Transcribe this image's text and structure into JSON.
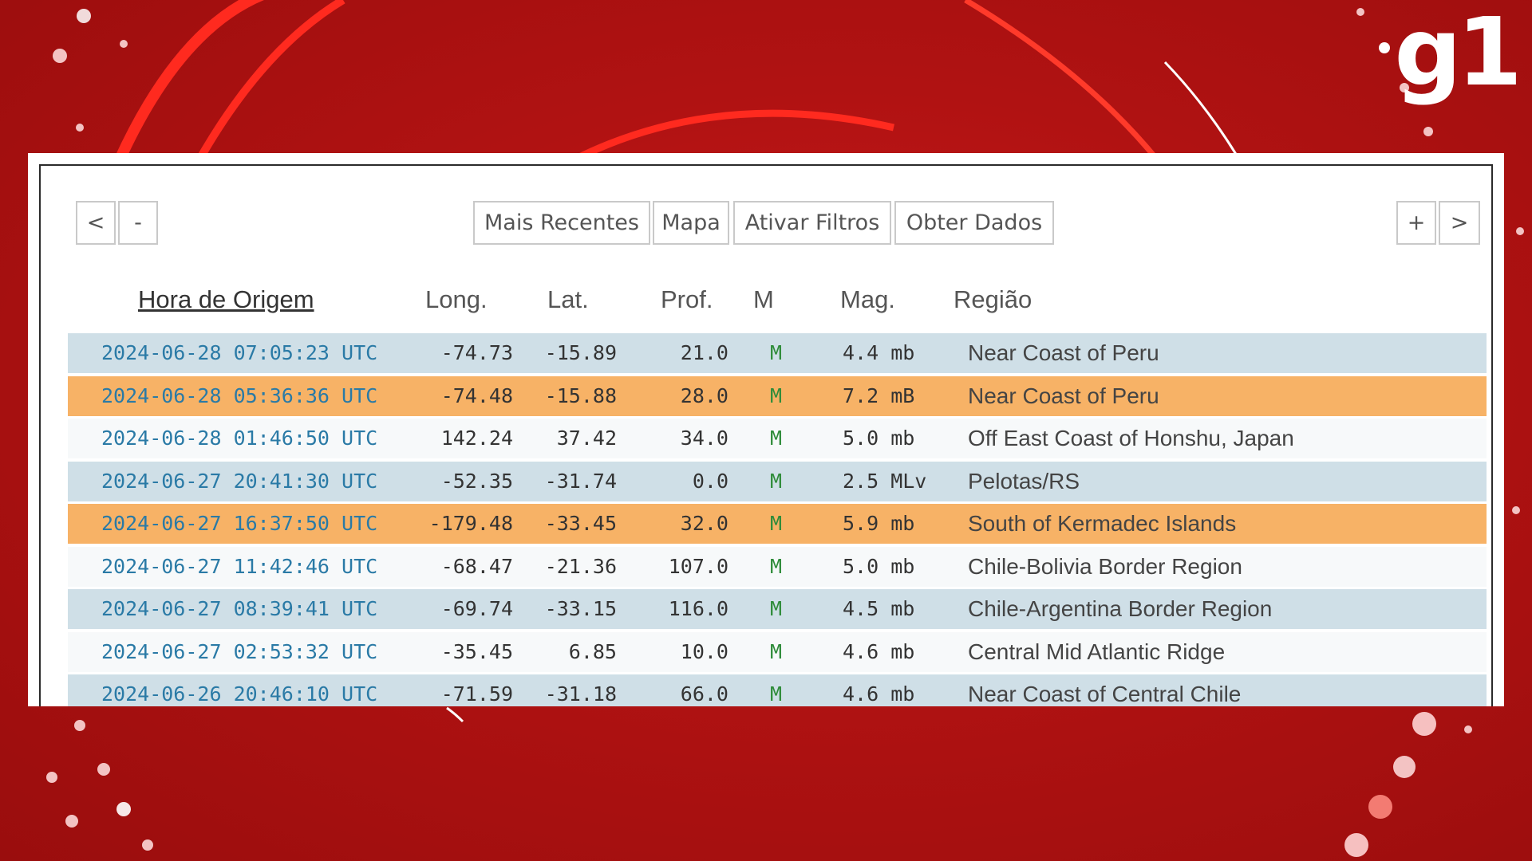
{
  "brand": {
    "logo_text": "g1",
    "accent": "#c8191a"
  },
  "toolbar": {
    "prev_label": "<",
    "zoom_out_label": "-",
    "recent_label": "Mais Recentes",
    "map_label": "Mapa",
    "filters_label": "Ativar Filtros",
    "data_label": "Obter Dados",
    "zoom_in_label": "+",
    "next_label": ">"
  },
  "table": {
    "headers": {
      "origin_time": "Hora de Origem",
      "longitude": "Long.",
      "latitude": "Lat.",
      "depth": "Prof.",
      "mode": "M",
      "magnitude": "Mag.",
      "region": "Região"
    },
    "rows": [
      {
        "time": "2024-06-28 07:05:23 UTC",
        "long": "-74.73",
        "lat": "-15.89",
        "prof": "21.0",
        "m": "M",
        "mag": "4.4 mb",
        "region": "Near Coast of Peru",
        "highlight": "blue"
      },
      {
        "time": "2024-06-28 05:36:36 UTC",
        "long": "-74.48",
        "lat": "-15.88",
        "prof": "28.0",
        "m": "M",
        "mag": "7.2 mB",
        "region": "Near Coast of Peru",
        "highlight": "orange"
      },
      {
        "time": "2024-06-28 01:46:50 UTC",
        "long": "142.24",
        "lat": "37.42",
        "prof": "34.0",
        "m": "M",
        "mag": "5.0 mb",
        "region": "Off East Coast of Honshu, Japan",
        "highlight": "white"
      },
      {
        "time": "2024-06-27 20:41:30 UTC",
        "long": "-52.35",
        "lat": "-31.74",
        "prof": "0.0",
        "m": "M",
        "mag": "2.5 MLv",
        "region": "Pelotas/RS",
        "highlight": "blue"
      },
      {
        "time": "2024-06-27 16:37:50 UTC",
        "long": "-179.48",
        "lat": "-33.45",
        "prof": "32.0",
        "m": "M",
        "mag": "5.9 mb",
        "region": "South of Kermadec Islands",
        "highlight": "orange"
      },
      {
        "time": "2024-06-27 11:42:46 UTC",
        "long": "-68.47",
        "lat": "-21.36",
        "prof": "107.0",
        "m": "M",
        "mag": "5.0 mb",
        "region": "Chile-Bolivia Border Region",
        "highlight": "white"
      },
      {
        "time": "2024-06-27 08:39:41 UTC",
        "long": "-69.74",
        "lat": "-33.15",
        "prof": "116.0",
        "m": "M",
        "mag": "4.5 mb",
        "region": "Chile-Argentina Border Region",
        "highlight": "blue"
      },
      {
        "time": "2024-06-27 02:53:32 UTC",
        "long": "-35.45",
        "lat": "6.85",
        "prof": "10.0",
        "m": "M",
        "mag": "4.6 mb",
        "region": "Central Mid Atlantic Ridge",
        "highlight": "white"
      },
      {
        "time": "2024-06-26 20:46:10 UTC",
        "long": "-71.59",
        "lat": "-31.18",
        "prof": "66.0",
        "m": "M",
        "mag": "4.6 mb",
        "region": "Near Coast of Central Chile",
        "highlight": "blue"
      }
    ]
  }
}
